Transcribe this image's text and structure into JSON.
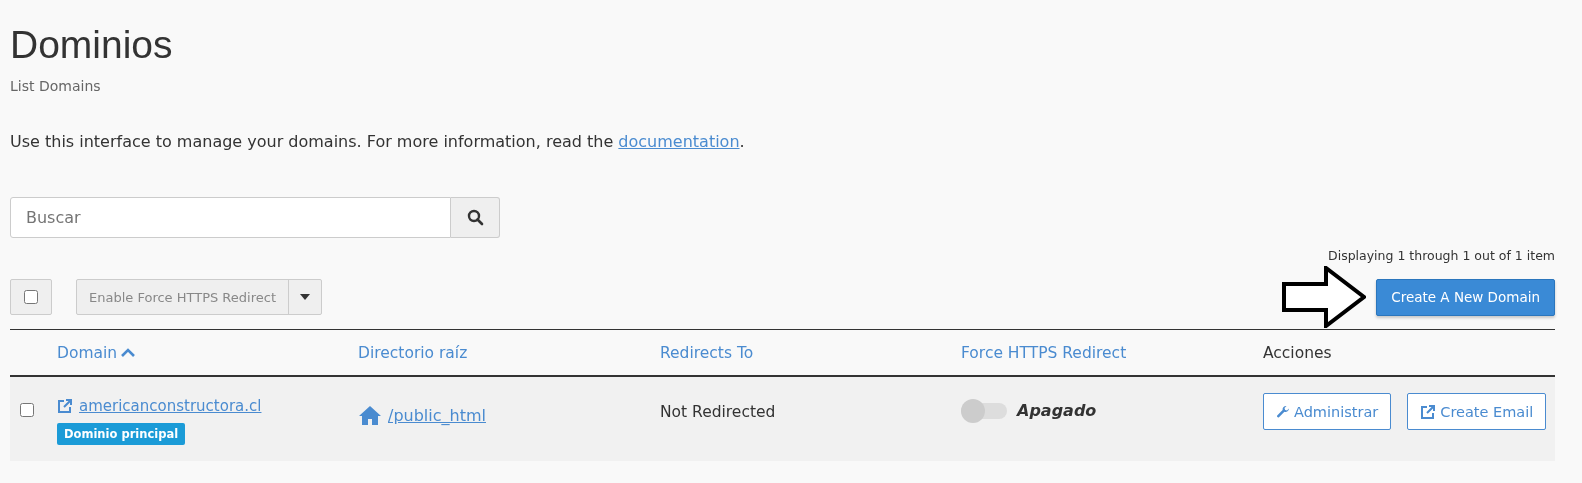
{
  "page": {
    "title": "Dominios",
    "subtitle": "List Domains",
    "intro": "Use this interface to manage your domains. For more information, read the ",
    "intro_link": "documentation",
    "intro_end": "."
  },
  "search": {
    "placeholder": "Buscar"
  },
  "pagination": "Displaying 1 through 1 out of 1 item",
  "toolbar": {
    "select_all": {
      "checked": false
    },
    "bulk_action": {
      "label": "Enable Force HTTPS Redirect",
      "disabled": true
    },
    "create_button": "Create A New Domain"
  },
  "table": {
    "columns": [
      {
        "label": "Domain",
        "sortable": true,
        "sorted": true,
        "ascending": true
      },
      {
        "label": "Directorio raíz",
        "sortable": true,
        "sorted": false
      },
      {
        "label": "Redirects To",
        "sortable": true,
        "sorted": false
      },
      {
        "label": "Force HTTPS Redirect",
        "sortable": true,
        "sorted": false
      },
      {
        "label": "Acciones",
        "sortable": false,
        "sorted": false
      }
    ],
    "rows": [
      {
        "checked": false,
        "domain": "americanconstructora.cl",
        "badge": "Dominio principal",
        "root": "/public_html",
        "redirect": "Not Redirected",
        "https": {
          "on": false,
          "label": "Apagado"
        },
        "actions": [
          {
            "kind": "manage",
            "label": "Administrar"
          },
          {
            "kind": "email",
            "label": "Create Email"
          }
        ]
      }
    ]
  }
}
